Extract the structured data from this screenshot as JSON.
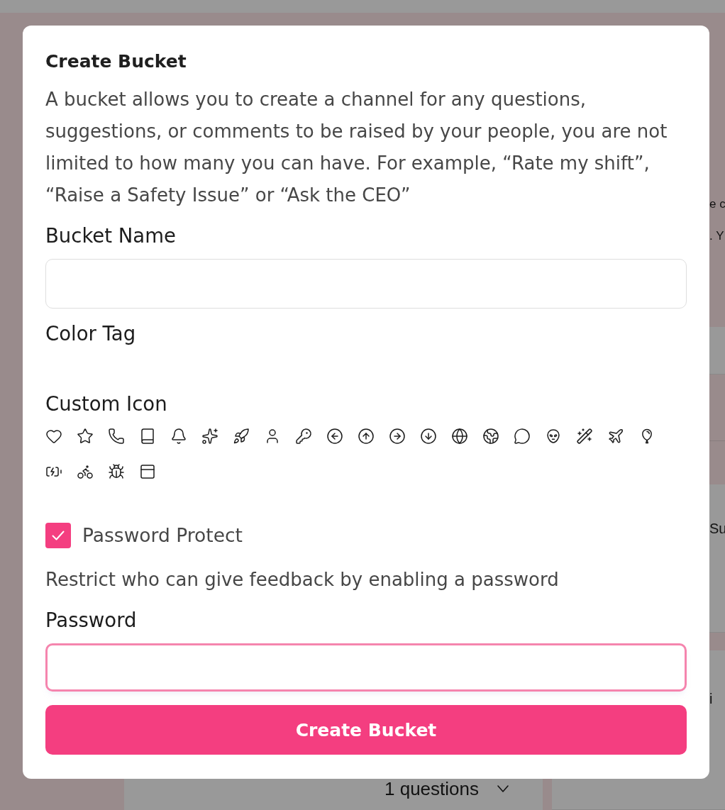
{
  "background": {
    "side_panel": {
      "lines": [
        "e c",
        ". Y"
      ]
    },
    "cards": [
      {
        "text": "Su"
      },
      {
        "text": "i"
      }
    ],
    "main_card": {
      "count": "1 questions"
    }
  },
  "dialog": {
    "title": "Create Bucket",
    "description": "A bucket allows you to create a channel for any questions, suggestions, or comments to be raised by your people, you are not limited to how many you can have. For example, “Rate my shift”,\n“Raise a Safety Issue” or “Ask the CEO”",
    "bucket_name": {
      "label": "Bucket Name",
      "focused": false
    },
    "color_tag": {
      "label": "Color Tag"
    },
    "custom_icon": {
      "label": "Custom Icon"
    },
    "password_protect": {
      "label": "Password Protect",
      "checked": true
    },
    "password_hint": "Restrict who can give feedback by enabling a password",
    "password": {
      "label": "Password",
      "focused": true
    },
    "submit": "Create Bucket"
  }
}
